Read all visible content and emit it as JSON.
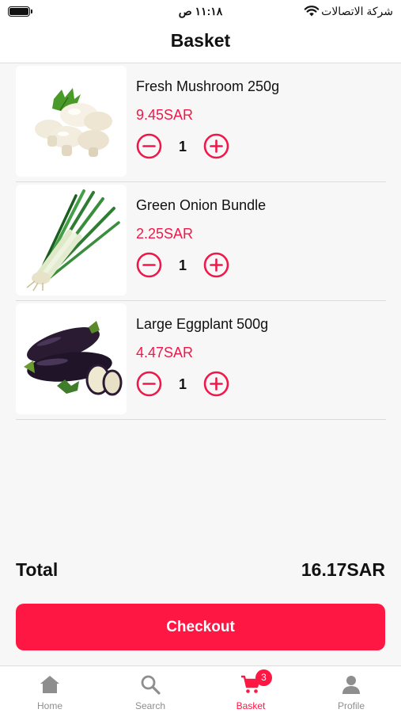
{
  "status_bar": {
    "time": "١١:١٨ ص",
    "carrier": "شركة الاتصالات"
  },
  "header": {
    "title": "Basket"
  },
  "basket": {
    "items": [
      {
        "name": "Fresh Mushroom 250g",
        "price": "9.45SAR",
        "quantity": "1",
        "image": "mushroom"
      },
      {
        "name": "Green Onion Bundle",
        "price": "2.25SAR",
        "quantity": "1",
        "image": "green-onion"
      },
      {
        "name": "Large Eggplant 500g",
        "price": "4.47SAR",
        "quantity": "1",
        "image": "eggplant"
      }
    ],
    "total_label": "Total",
    "total_value": "16.17SAR",
    "checkout_label": "Checkout"
  },
  "tab_bar": {
    "tabs": [
      {
        "label": "Home",
        "icon": "home-icon",
        "active": false
      },
      {
        "label": "Search",
        "icon": "search-icon",
        "active": false
      },
      {
        "label": "Basket",
        "icon": "cart-icon",
        "active": true,
        "badge": "3"
      },
      {
        "label": "Profile",
        "icon": "person-icon",
        "active": false
      }
    ]
  },
  "colors": {
    "accent": "#ff1744",
    "price": "#f0184a",
    "inactive": "#8e8e8e",
    "background": "#f7f7f7"
  }
}
